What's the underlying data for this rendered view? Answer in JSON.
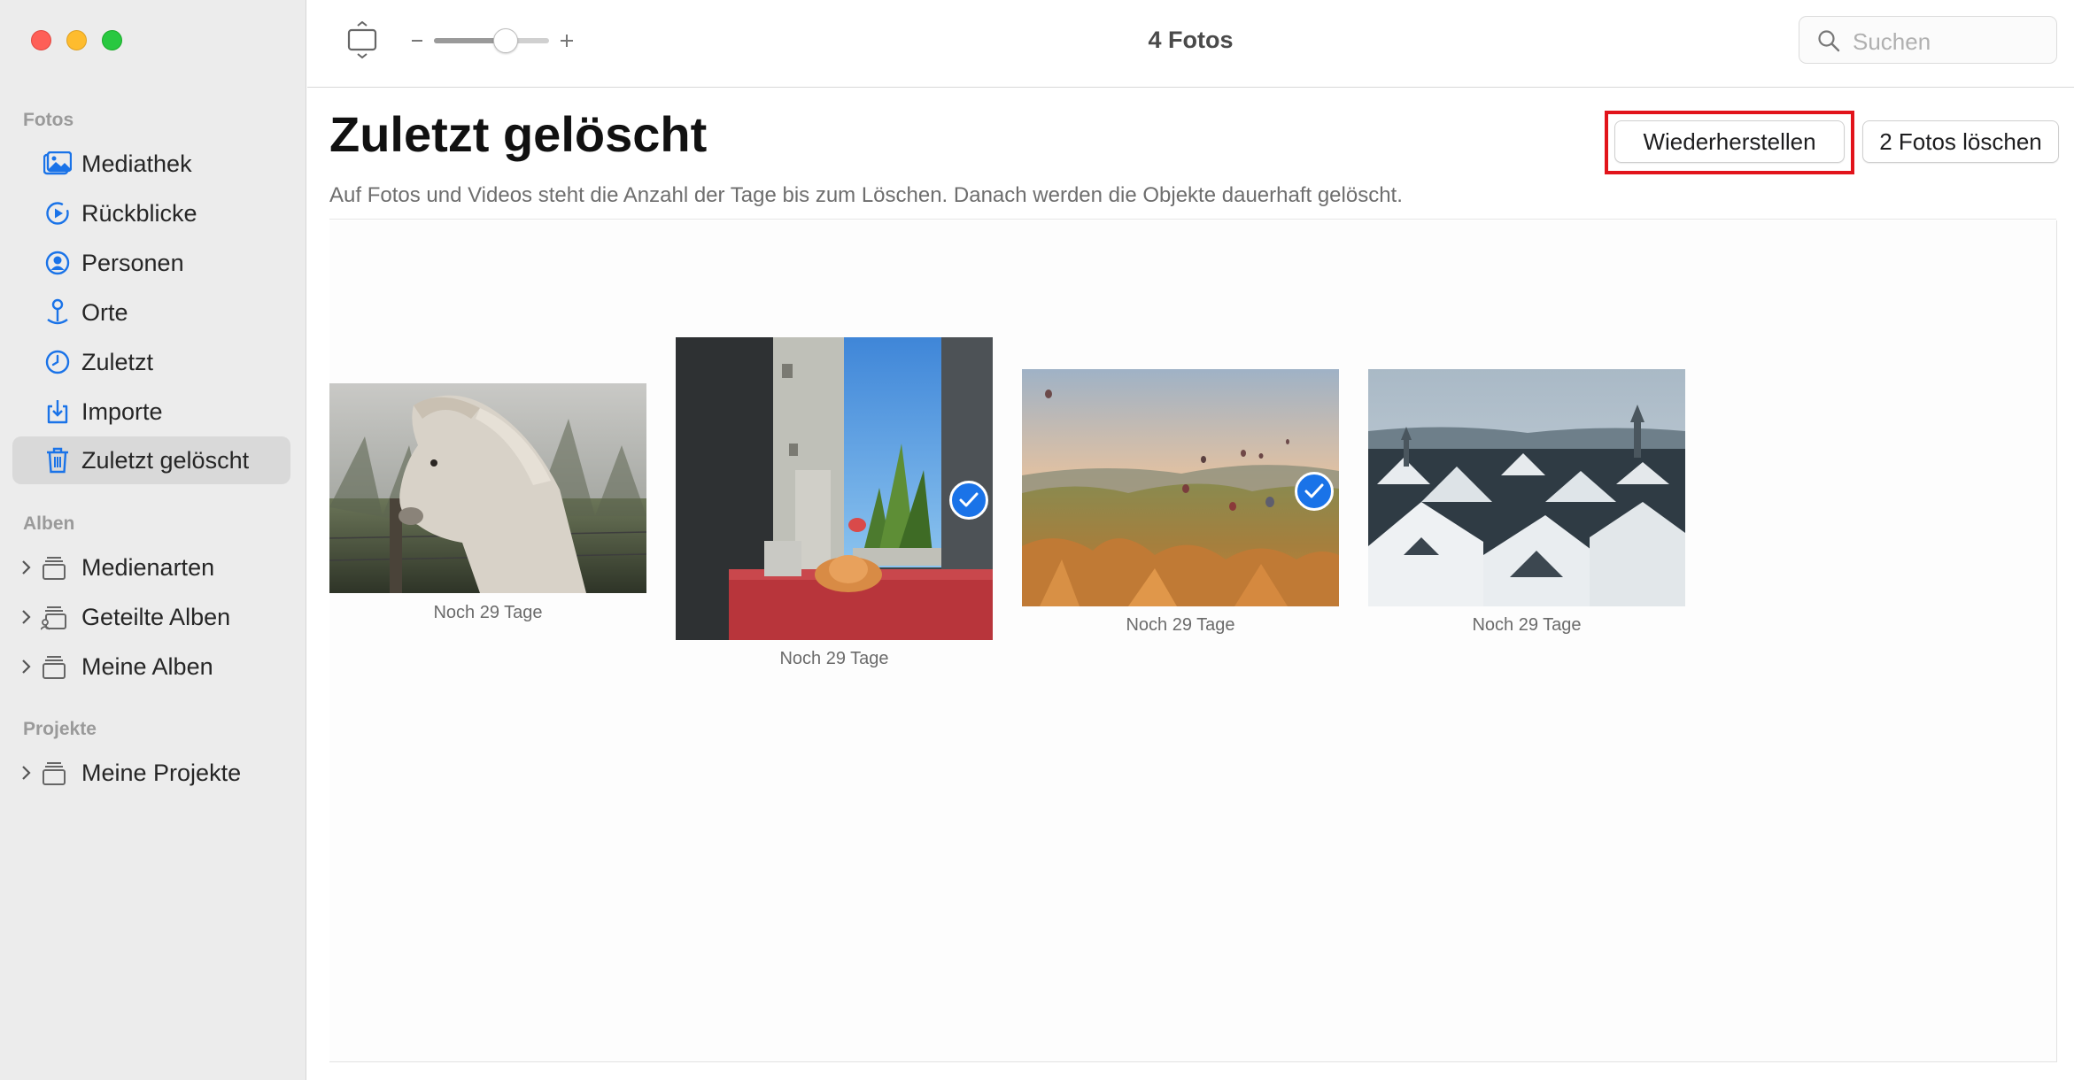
{
  "window": {
    "title": "4 Fotos",
    "search_placeholder": "Suchen"
  },
  "sidebar": {
    "section_photos": "Fotos",
    "items": [
      {
        "label": "Mediathek",
        "icon": "photo-library-icon"
      },
      {
        "label": "Rückblicke",
        "icon": "memories-icon"
      },
      {
        "label": "Personen",
        "icon": "person-icon"
      },
      {
        "label": "Orte",
        "icon": "pin-icon"
      },
      {
        "label": "Zuletzt",
        "icon": "clock-icon"
      },
      {
        "label": "Importe",
        "icon": "import-icon"
      },
      {
        "label": "Zuletzt gelöscht",
        "icon": "trash-icon",
        "active": true
      }
    ],
    "section_albums": "Alben",
    "albums": [
      {
        "label": "Medienarten",
        "icon": "album-stack-icon"
      },
      {
        "label": "Geteilte Alben",
        "icon": "shared-album-icon"
      },
      {
        "label": "Meine Alben",
        "icon": "album-stack-icon"
      }
    ],
    "section_projects": "Projekte",
    "projects": [
      {
        "label": "Meine Projekte",
        "icon": "album-stack-icon"
      }
    ]
  },
  "main": {
    "title": "Zuletzt gelöscht",
    "subtitle": "Auf Fotos und Videos steht die Anzahl der Tage bis zum Löschen. Danach werden die Objekte dauerhaft gelöscht.",
    "restore_button": "Wiederherstellen",
    "delete_button": "2 Fotos löschen",
    "photos": [
      {
        "subject": "horse",
        "caption": "Noch 29 Tage",
        "selected": false
      },
      {
        "subject": "window-cat",
        "caption": "Noch 29 Tage",
        "selected": true
      },
      {
        "subject": "balloons-valley",
        "caption": "Noch 29 Tage",
        "selected": true
      },
      {
        "subject": "snowy-city",
        "caption": "Noch 29 Tage",
        "selected": false
      }
    ]
  },
  "colors": {
    "accent": "#1a73e8",
    "highlight": "#e2141b",
    "sidebar_bg": "#ececec"
  }
}
